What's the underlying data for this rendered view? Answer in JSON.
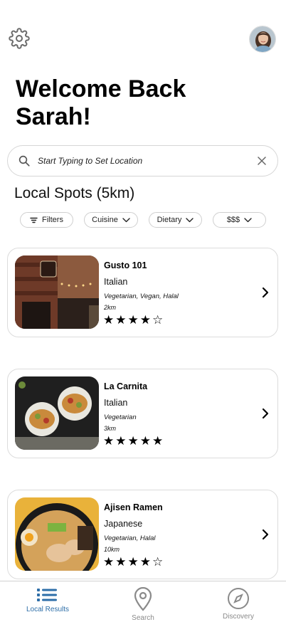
{
  "header": {
    "welcome_line1": "Welcome Back",
    "welcome_line2": "Sarah!"
  },
  "search": {
    "placeholder": "Start Typing to Set Location",
    "value": ""
  },
  "section": {
    "title": "Local Spots (5km)"
  },
  "filters": [
    {
      "label": "Filters",
      "icon": "filter-icon"
    },
    {
      "label": "Cuisine",
      "icon": "chevron-down-icon"
    },
    {
      "label": "Dietary",
      "icon": "chevron-down-icon"
    },
    {
      "label": "$$$",
      "icon": "chevron-down-icon"
    }
  ],
  "restaurants": [
    {
      "name": "Gusto 101",
      "cuisine": "Italian",
      "dietary": "Vegetarian, Vegan, Halal",
      "distance": "2km",
      "rating": 4,
      "rating_max": 5
    },
    {
      "name": "La Carnita",
      "cuisine": "Italian",
      "dietary": "Vegetarian",
      "distance": "3km",
      "rating": 5,
      "rating_max": 5
    },
    {
      "name": "Ajisen Ramen",
      "cuisine": "Japanese",
      "dietary": "Vegetarian, Halal",
      "distance": "10km",
      "rating": 4,
      "rating_max": 5
    }
  ],
  "nav": {
    "items": [
      {
        "label": "Local Results",
        "icon": "list-icon",
        "active": true
      },
      {
        "label": "Search",
        "icon": "map-pin-icon",
        "active": false
      },
      {
        "label": "Discovery",
        "icon": "compass-icon",
        "active": false
      }
    ]
  },
  "colors": {
    "accent": "#2d6ea8",
    "inactive": "#8a8a8a",
    "border": "#dcdcdc"
  }
}
